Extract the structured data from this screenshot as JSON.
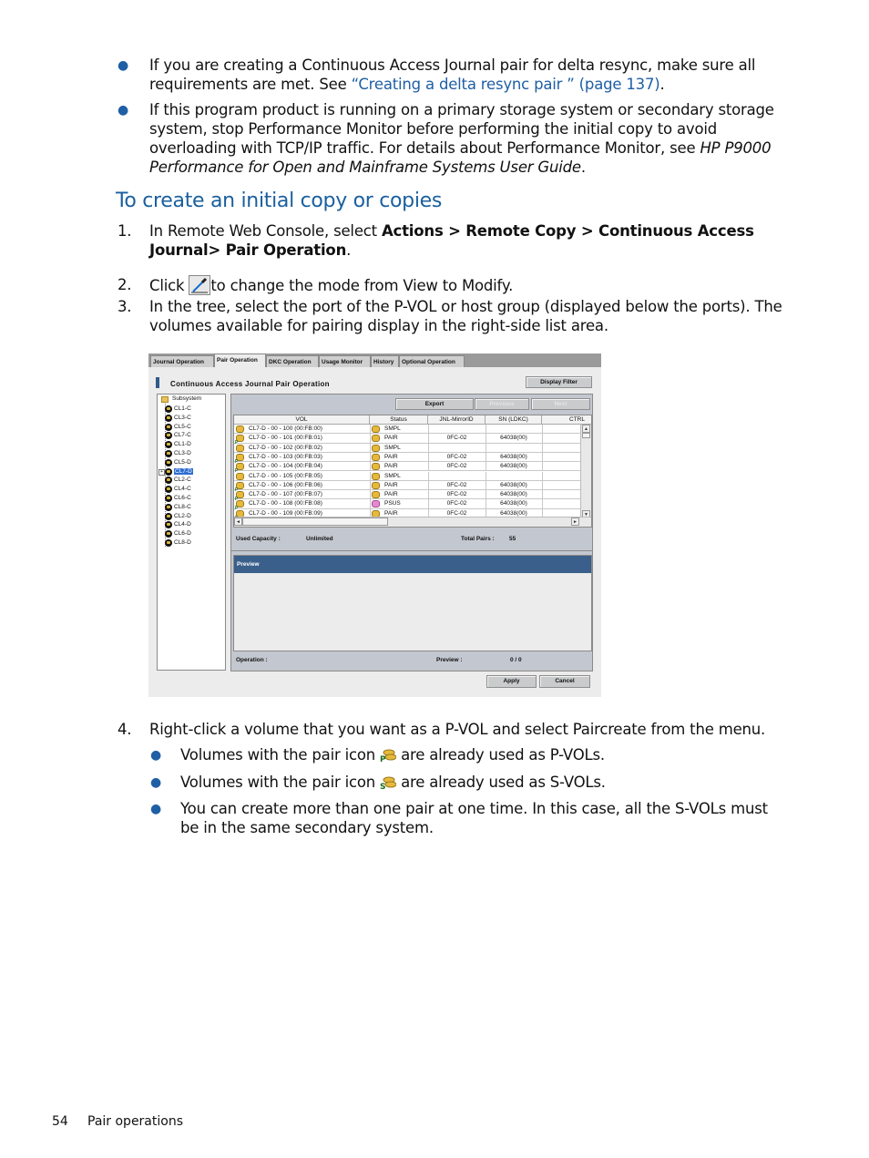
{
  "bullets_top": [
    {
      "text_before": "If you are creating a Continuous Access Journal pair for delta resync, make sure all requirements are met. See ",
      "link": "“Creating a delta resync pair ” (page 137)",
      "text_after": "."
    },
    {
      "text_before": "If this program product is running on a primary storage system or secondary storage system, stop Performance Monitor before performing the initial copy to avoid overloading with TCP/IP traffic. For details about Performance Monitor, see ",
      "italic": "HP P9000 Performance for Open and Mainframe Systems User Guide",
      "text_after": "."
    }
  ],
  "section_heading": "To create an initial copy or copies",
  "steps": [
    {
      "num": "1.",
      "text_before": "In Remote Web Console, select ",
      "bold": "Actions > Remote Copy > Continuous Access Journal> Pair Operation",
      "text_after": "."
    },
    {
      "num": "2.",
      "text_before": "Click ",
      "icon": "modify-mode-pen-icon",
      "text_after": "to change the mode from View to Modify."
    },
    {
      "num": "3.",
      "text": "In the tree, select the port of the P-VOL or host group (displayed below the ports). The volumes available for pairing display in the right-side list area."
    },
    {
      "num": "4.",
      "text": "Right-click a volume that you want as a P-VOL and select Paircreate from the menu.",
      "subbullets": [
        {
          "text_before": "Volumes with the pair icon ",
          "icon": "p-vol-pair-icon",
          "text_after": " are already used as P-VOLs."
        },
        {
          "text_before": "Volumes with the pair icon ",
          "icon": "s-vol-pair-icon",
          "text_after": " are already used as S-VOLs."
        },
        {
          "text": "You can create more than one pair at one time. In this case, all the S-VOLs must be in the same secondary system."
        }
      ]
    }
  ],
  "screenshot": {
    "tabs": [
      "Journal Operation",
      "Pair Operation",
      "DKC Operation",
      "Usage Monitor",
      "History",
      "Optional Operation"
    ],
    "active_tab": "Pair Operation",
    "panel_title": "Continuous Access Journal Pair Operation",
    "display_filter_button": "Display Filter",
    "export_button": "Export",
    "previous_button": "Previous",
    "next_button": "Next",
    "tree": {
      "root": "Subsystem",
      "items": [
        "CL1-C",
        "CL3-C",
        "CL5-C",
        "CL7-C",
        "CL1-D",
        "CL3-D",
        "CL5-D",
        "CL7-D",
        "CL2-C",
        "CL4-C",
        "CL6-C",
        "CL8-C",
        "CL2-D",
        "CL4-D",
        "CL6-D",
        "CL8-D"
      ],
      "selected": "CL7-D"
    },
    "table": {
      "columns": [
        "VOL",
        "Status",
        "JNL-MirrorID",
        "SN (LDKC)",
        "CTRL"
      ],
      "rows": [
        {
          "vol": "CL7-D - 00 - 100 (00:FB:00)",
          "status": "SMPL",
          "mirror": "",
          "sn": "",
          "ctrl": "",
          "vol_icon": "smpl",
          "status_icon": "smpl"
        },
        {
          "vol": "CL7-D - 00 - 101 (00:FB:01)",
          "status": "PAIR",
          "mirror": "0FC-02",
          "sn": "64038(00)",
          "ctrl": "",
          "vol_icon": "p-vol",
          "status_icon": "pair"
        },
        {
          "vol": "CL7-D - 00 - 102 (00:FB:02)",
          "status": "SMPL",
          "mirror": "",
          "sn": "",
          "ctrl": "",
          "vol_icon": "smpl",
          "status_icon": "smpl"
        },
        {
          "vol": "CL7-D - 00 - 103 (00:FB:03)",
          "status": "PAIR",
          "mirror": "0FC-02",
          "sn": "64038(00)",
          "ctrl": "",
          "vol_icon": "p-vol",
          "status_icon": "pair"
        },
        {
          "vol": "CL7-D - 00 - 104 (00:FB:04)",
          "status": "PAIR",
          "mirror": "0FC-02",
          "sn": "64038(00)",
          "ctrl": "",
          "vol_icon": "p-vol",
          "status_icon": "pair"
        },
        {
          "vol": "CL7-D - 00 - 105 (00:FB:05)",
          "status": "SMPL",
          "mirror": "",
          "sn": "",
          "ctrl": "",
          "vol_icon": "smpl",
          "status_icon": "smpl"
        },
        {
          "vol": "CL7-D - 00 - 106 (00:FB:06)",
          "status": "PAIR",
          "mirror": "0FC-02",
          "sn": "64038(00)",
          "ctrl": "",
          "vol_icon": "p-vol",
          "status_icon": "pair"
        },
        {
          "vol": "CL7-D - 00 - 107 (00:FB:07)",
          "status": "PAIR",
          "mirror": "0FC-02",
          "sn": "64038(00)",
          "ctrl": "",
          "vol_icon": "p-vol",
          "status_icon": "pair"
        },
        {
          "vol": "CL7-D - 00 - 108 (00:FB:08)",
          "status": "PSUS",
          "mirror": "0FC-02",
          "sn": "64038(00)",
          "ctrl": "",
          "vol_icon": "p-vol",
          "status_icon": "psus"
        },
        {
          "vol": "CL7-D - 00 - 109 (00:FB:09)",
          "status": "PAIR",
          "mirror": "0FC-02",
          "sn": "64038(00)",
          "ctrl": "",
          "vol_icon": "p-vol",
          "status_icon": "pair"
        }
      ]
    },
    "used_capacity_label": "Used Capacity :",
    "used_capacity_value": "Unlimited",
    "total_pairs_label": "Total Pairs :",
    "total_pairs_value": "55",
    "preview_title": "Preview",
    "operation_label": "Operation :",
    "preview_label": "Preview :",
    "preview_value": "0 / 0",
    "apply_button": "Apply",
    "cancel_button": "Cancel"
  },
  "footer": {
    "page_number": "54",
    "section": "Pair operations"
  },
  "colors": {
    "heading": "#1a5f9e",
    "link": "#1f5fa5",
    "preview_bar": "#3a5f8a",
    "selection": "#2f6fd0"
  }
}
